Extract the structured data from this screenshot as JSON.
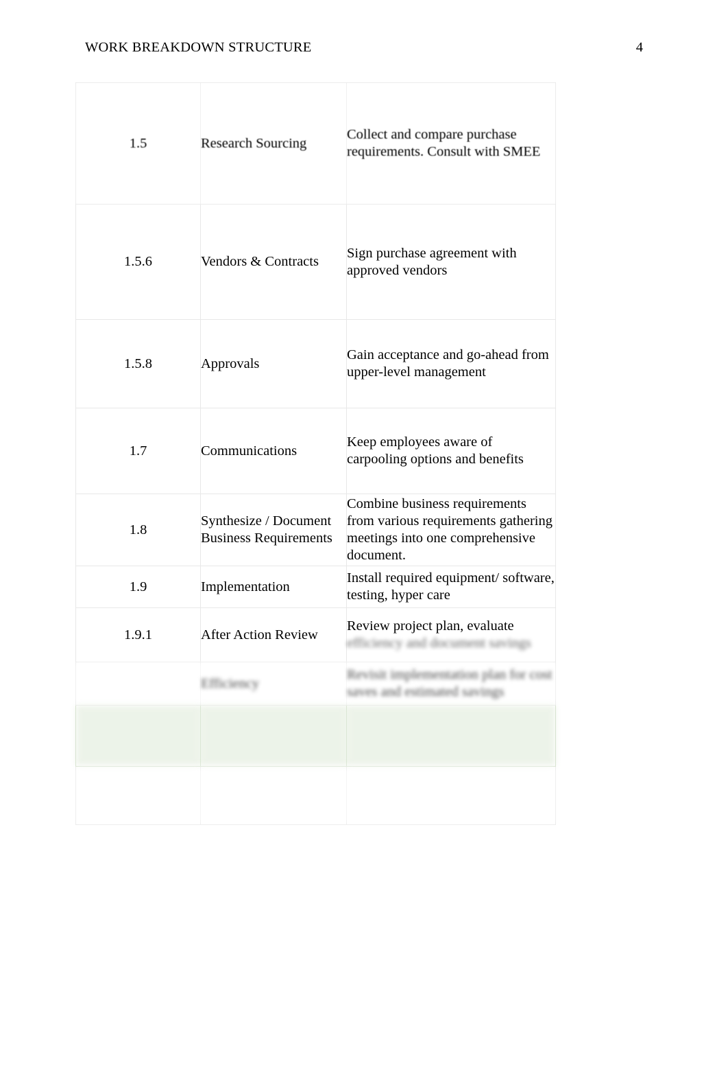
{
  "header": {
    "title": "WORK BREAKDOWN STRUCTURE",
    "page_number": "4"
  },
  "colors": {
    "page_background": "#ffffff",
    "text": "#000000",
    "table_border": "#e8e8e8",
    "highlight_row": "#e2ecdc"
  },
  "table": {
    "columns": [
      "wbs_id",
      "task_name",
      "description"
    ],
    "rows": [
      {
        "id": "1.5",
        "name": "Research Sourcing",
        "description": "Collect and compare purchase requirements.  Consult with SMEE",
        "highlight": false,
        "legibility": "clear"
      },
      {
        "id": "1.5.6",
        "name": "Vendors & Contracts",
        "description": "Sign purchase agreement with approved vendors",
        "highlight": false,
        "legibility": "clear"
      },
      {
        "id": "1.5.8",
        "name": "Approvals",
        "description": "Gain acceptance and go-ahead from upper-level management",
        "highlight": false,
        "legibility": "clear"
      },
      {
        "id": "1.7",
        "name": "Communications",
        "description": "Keep employees aware of carpooling options and benefits",
        "highlight": false,
        "legibility": "clear"
      },
      {
        "id": "1.8",
        "name": "Synthesize / Document Business Requirements",
        "description": "Combine business requirements from various requirements gathering meetings into one comprehensive document.",
        "highlight": false,
        "legibility": "clear"
      },
      {
        "id": "1.9",
        "name": "Implementation",
        "description": "Install required equipment/ software, testing, hyper care",
        "highlight": false,
        "legibility": "clear"
      },
      {
        "id": "1.9.1",
        "name": "After Action Review",
        "description_visible": "Review project plan, evaluate",
        "description_blurred": "efficiency and document savings",
        "highlight": false,
        "legibility": "partially-blurred"
      },
      {
        "id": "",
        "name": "Efficiency",
        "description_blurred": "Revisit implementation plan for cost saves and estimated savings",
        "highlight": false,
        "legibility": "blurred"
      },
      {
        "id": "",
        "name": "",
        "description": "",
        "highlight": true,
        "legibility": "blurred"
      },
      {
        "id": "",
        "name": "",
        "description": "",
        "highlight": false,
        "legibility": "blurred"
      }
    ]
  }
}
